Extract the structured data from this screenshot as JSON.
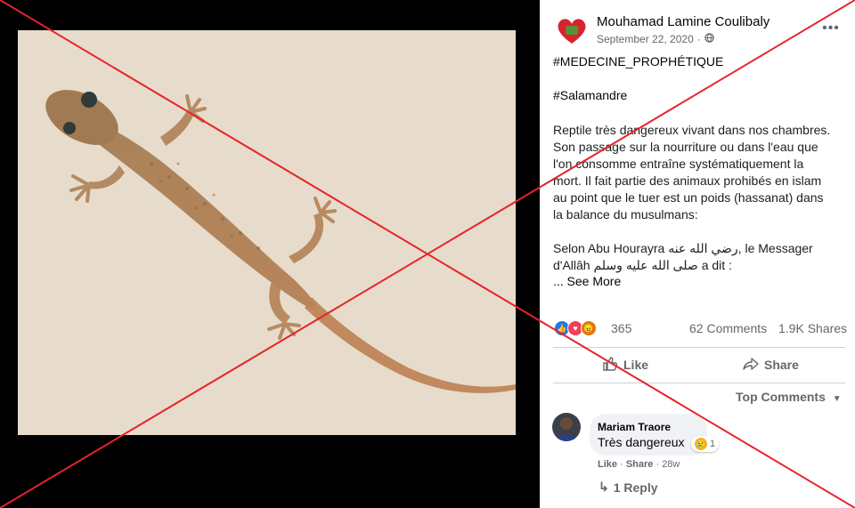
{
  "colors": {
    "accent": "#1877f2",
    "muted": "#65676b",
    "cross": "#e8222a"
  },
  "post": {
    "author": "Mouhamad Lamine Coulibaly",
    "date": "September 22, 2020",
    "audience_icon": "globe-icon",
    "more_icon": "more-options-icon",
    "hashtag1": "#MEDECINE_PROPHÉTIQUE",
    "hashtag2": "#Salamandre",
    "body_lines": [
      "Reptile très dangereux vivant dans nos chambres.",
      "Son passage sur la nourriture ou dans l'eau que",
      "l'on consomme entraîne systématiquement la",
      "mort. Il fait partie des animaux prohibés en islam",
      "au point que le tuer est un poids (hassanat) dans",
      "la balance du musulmans:"
    ],
    "quote_lines": [
      "Selon Abu Hourayra رضي الله عنه, le Messager",
      "d'Allâh صلى الله عليه وسلم a dit :"
    ],
    "see_more": "... See More"
  },
  "stats": {
    "reaction_icons": [
      "like-reaction-icon",
      "love-reaction-icon",
      "angry-reaction-icon"
    ],
    "reactions": "365",
    "comments": "62 Comments",
    "shares": "1.9K Shares"
  },
  "actions": {
    "like": "Like",
    "share": "Share"
  },
  "comments_sort": "Top Comments",
  "comment": {
    "author": "Mariam Traore",
    "text": "Très dangereux",
    "reaction_count": "1",
    "like": "Like",
    "share": "Share",
    "age": "28w"
  },
  "reply_link": "1 Reply"
}
